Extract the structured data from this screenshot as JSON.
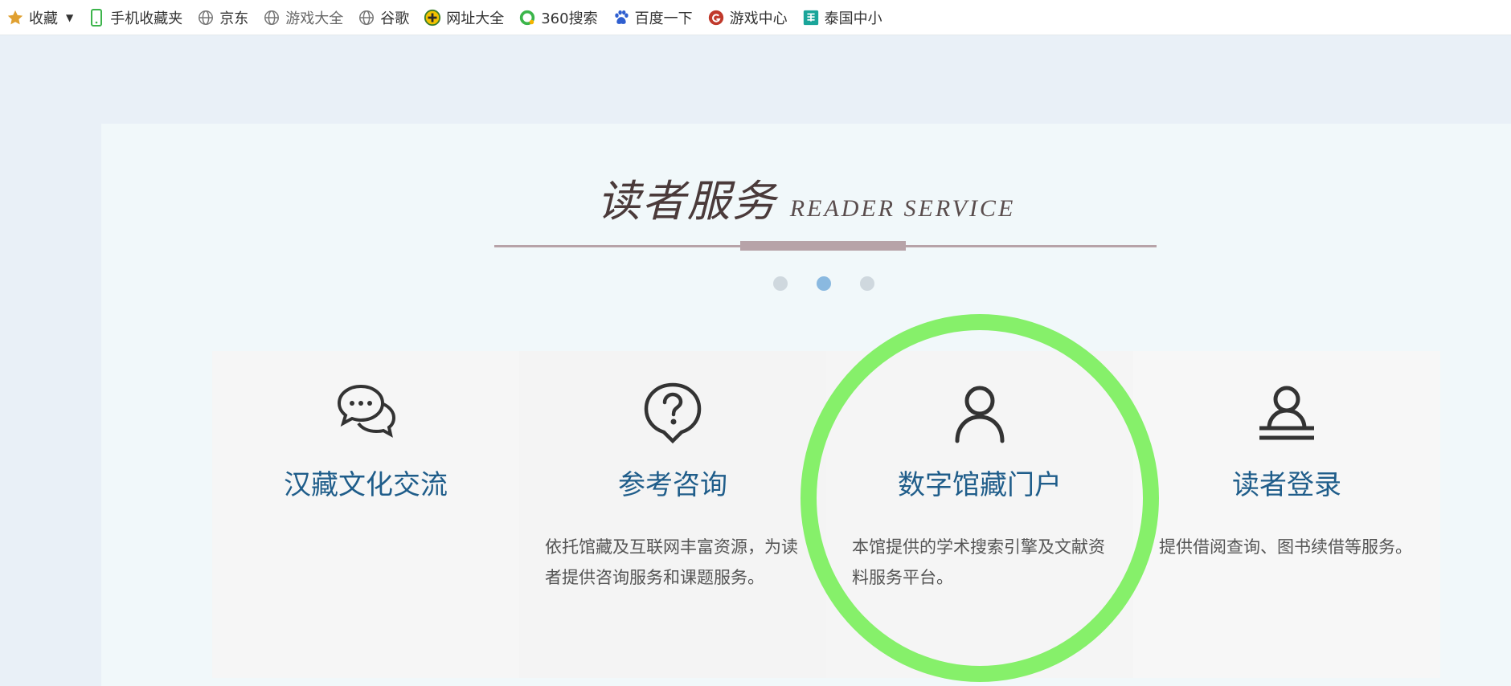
{
  "bookmarks": {
    "favorites_label": "收藏",
    "items": [
      {
        "label": "手机收藏夹",
        "icon": "phone-icon"
      },
      {
        "label": "京东",
        "icon": "globe-icon"
      },
      {
        "label": "游戏大全",
        "icon": "globe-icon"
      },
      {
        "label": "谷歌",
        "icon": "globe-icon"
      },
      {
        "label": "网址大全",
        "icon": "plus-badge-icon"
      },
      {
        "label": "360搜索",
        "icon": "ring-icon"
      },
      {
        "label": "百度一下",
        "icon": "paw-icon"
      },
      {
        "label": "游戏中心",
        "icon": "game-icon"
      },
      {
        "label": "泰国中小",
        "icon": "book-icon"
      }
    ]
  },
  "section": {
    "title_zh": "读者服务",
    "title_en": "READER SERVICE"
  },
  "carousel": {
    "dots": 3,
    "active_index": 1
  },
  "cards": [
    {
      "title": "汉藏文化交流",
      "desc": "",
      "icon": "chat-bubbles-icon"
    },
    {
      "title": "参考咨询",
      "desc": "依托馆藏及互联网丰富资源，为读者提供咨询服务和课题服务。",
      "icon": "question-bubble-icon"
    },
    {
      "title": "数字馆藏门户",
      "desc": "本馆提供的学术搜索引擎及文献资料服务平台。",
      "icon": "person-icon"
    },
    {
      "title": "读者登录",
      "desc": "提供借阅查询、图书续借等服务。",
      "icon": "person-login-icon"
    }
  ],
  "colors": {
    "card_title": "#1f5d8a",
    "highlight_ring": "#86f06a",
    "active_dot": "#8ab9e0",
    "title_line": "#b7a3a8"
  }
}
